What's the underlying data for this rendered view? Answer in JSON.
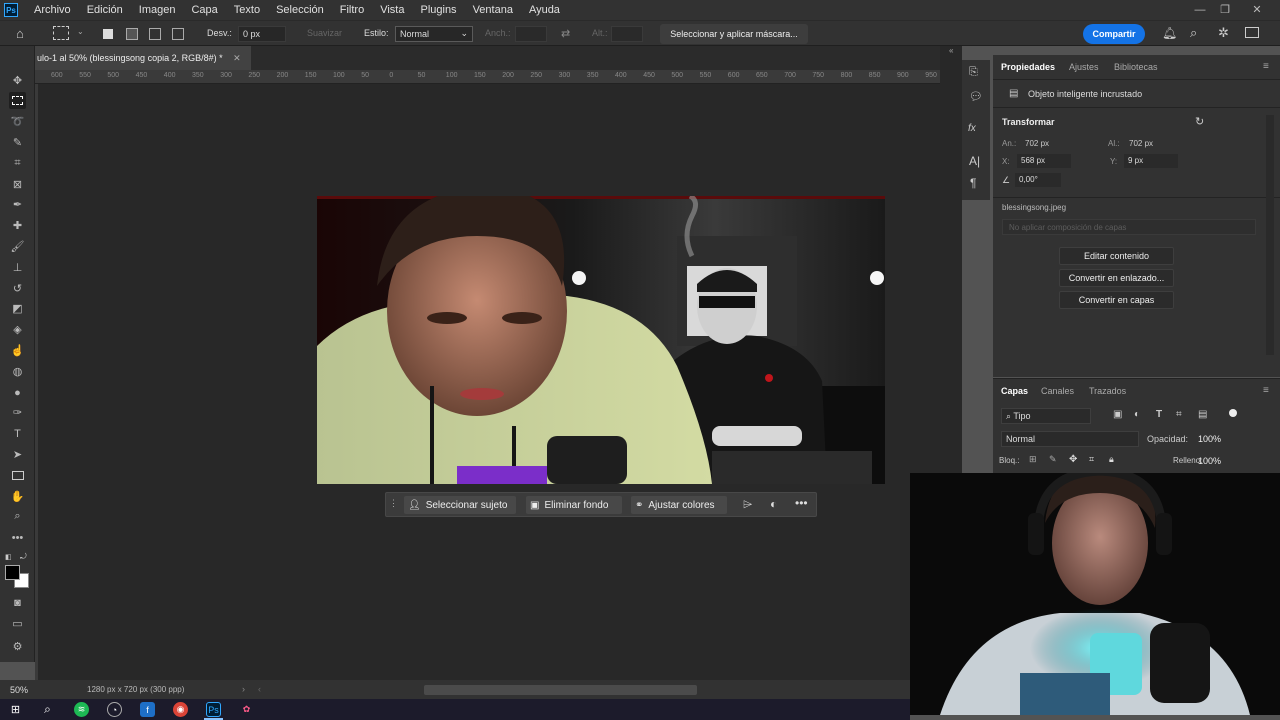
{
  "menubar": {
    "logo": "Ps",
    "items": [
      "Archivo",
      "Edición",
      "Imagen",
      "Capa",
      "Texto",
      "Selección",
      "Filtro",
      "Vista",
      "Plugins",
      "Ventana",
      "Ayuda"
    ]
  },
  "options": {
    "feather_label": "Desv.:",
    "feather_value": "0 px",
    "smooth_label": "Suavizar",
    "style_label": "Estilo:",
    "style_value": "Normal",
    "width_label": "Anch.:",
    "height_label": "Alt.:",
    "mask_button": "Seleccionar y aplicar máscara...",
    "share_button": "Compartir"
  },
  "document": {
    "tab_title": "ulo-1 al 50% (blessingsong copia 2, RGB/8#) *",
    "ruler_ticks": [
      "600",
      "550",
      "500",
      "450",
      "400",
      "350",
      "300",
      "250",
      "200",
      "150",
      "100",
      "50",
      "0",
      "50",
      "100",
      "150",
      "200",
      "250",
      "300",
      "350",
      "400",
      "450",
      "500",
      "550",
      "600",
      "650",
      "700",
      "750",
      "800",
      "850",
      "900",
      "950"
    ]
  },
  "context_bar": {
    "select_subject": "Seleccionar sujeto",
    "remove_bg": "Eliminar fondo",
    "adjust_colors": "Ajustar colores"
  },
  "properties": {
    "tabs": [
      "Propiedades",
      "Ajustes",
      "Bibliotecas"
    ],
    "object_type": "Objeto inteligente incrustado",
    "section": "Transformar",
    "w_label": "An.:",
    "w_value": "702 px",
    "h_label": "Al.:",
    "h_value": "702 px",
    "x_label": "X:",
    "x_value": "568 px",
    "y_label": "Y:",
    "y_value": "9 px",
    "angle_value": "0,00°",
    "filename": "blessingsong.jpeg",
    "comp_placeholder": "No aplicar composición de capas",
    "btn_edit": "Editar contenido",
    "btn_linked": "Convertir en enlazado...",
    "btn_layers": "Convertir en capas"
  },
  "layers": {
    "tabs": [
      "Capas",
      "Canales",
      "Trazados"
    ],
    "filter": "Tipo",
    "blend_mode": "Normal",
    "opacity_label": "Opacidad:",
    "opacity_value": "100%",
    "lock_label": "Bloq.:",
    "fill_label": "Relleno:",
    "fill_value": "100%"
  },
  "status": {
    "zoom": "50%",
    "doc_info": "1280 px x 720 px (300 ppp)"
  },
  "taskbar": {
    "photoshop": "Ps"
  },
  "colors": {
    "accent": "#1473e6",
    "panel": "#323232",
    "canvas": "#282828"
  }
}
